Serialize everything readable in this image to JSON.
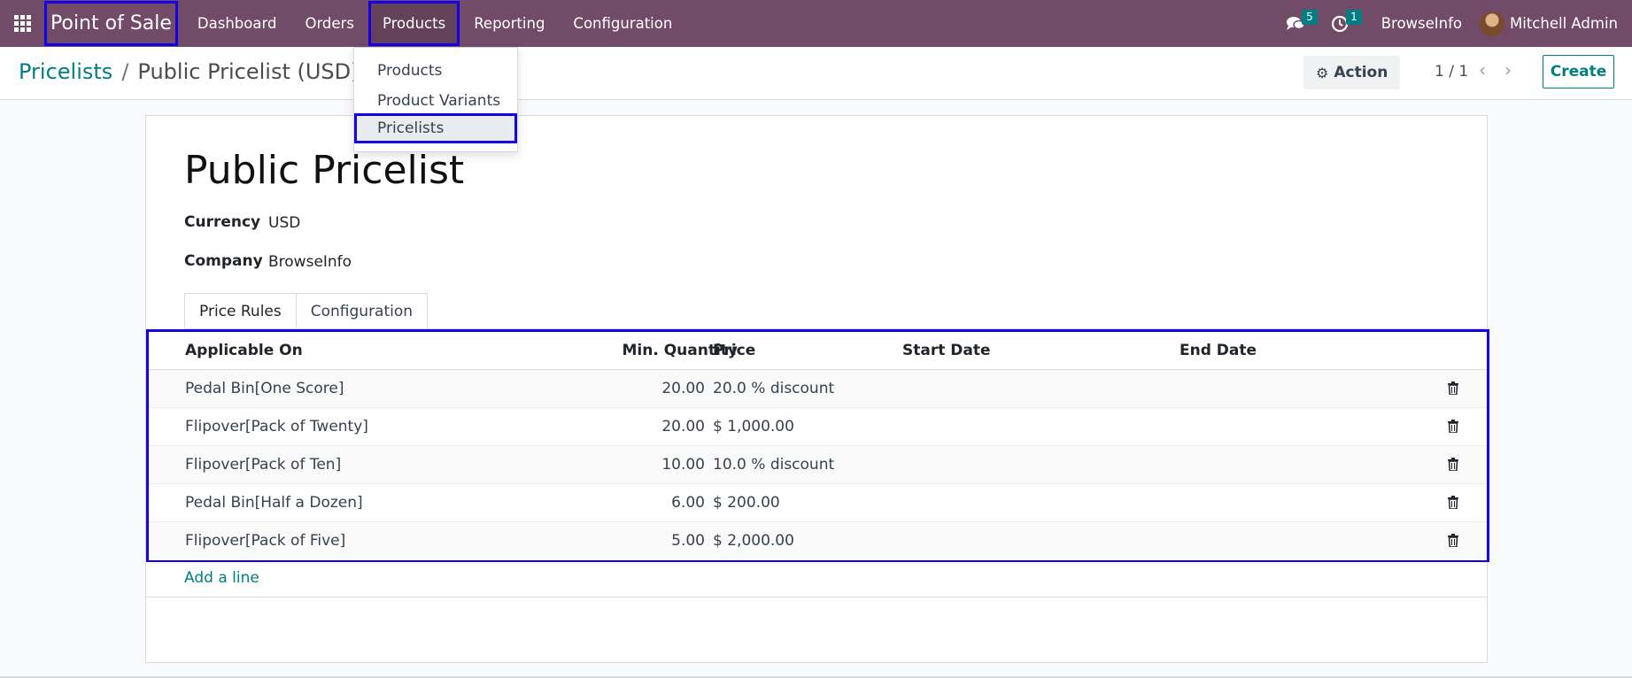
{
  "navbar": {
    "brand": "Point of Sale",
    "items": [
      {
        "label": "Dashboard"
      },
      {
        "label": "Orders"
      },
      {
        "label": "Products"
      },
      {
        "label": "Reporting"
      },
      {
        "label": "Configuration"
      }
    ],
    "messages_count": "5",
    "activities_count": "1",
    "company": "BrowseInfo",
    "user": "Mitchell Admin"
  },
  "products_menu": {
    "items": [
      {
        "label": "Products"
      },
      {
        "label": "Product Variants"
      },
      {
        "label": "Pricelists"
      }
    ]
  },
  "breadcrumb": {
    "parent": "Pricelists",
    "separator": "/",
    "current": "Public Pricelist (USD)"
  },
  "control": {
    "action_label": "Action",
    "pager": "1 / 1",
    "create_label": "Create"
  },
  "form": {
    "title": "Public Pricelist",
    "currency_label": "Currency",
    "currency_value": "USD",
    "company_label": "Company",
    "company_value": "BrowseInfo"
  },
  "tabs": [
    {
      "label": "Price Rules"
    },
    {
      "label": "Configuration"
    }
  ],
  "rules_table": {
    "headers": {
      "applicable_on": "Applicable On",
      "min_quantity": "Min. Quantity",
      "price": "Price",
      "start_date": "Start Date",
      "end_date": "End Date"
    },
    "rows": [
      {
        "applicable_on": "Pedal Bin[One Score]",
        "min_quantity": "20.00",
        "price": "20.0 % discount"
      },
      {
        "applicable_on": "Flipover[Pack of Twenty]",
        "min_quantity": "20.00",
        "price": "$ 1,000.00"
      },
      {
        "applicable_on": "Flipover[Pack of Ten]",
        "min_quantity": "10.00",
        "price": "10.0 % discount"
      },
      {
        "applicable_on": "Pedal Bin[Half a Dozen]",
        "min_quantity": "6.00",
        "price": "$ 200.00"
      },
      {
        "applicable_on": "Flipover[Pack of Five]",
        "min_quantity": "5.00",
        "price": "$ 2,000.00"
      }
    ],
    "add_line_label": "Add a line"
  },
  "colors": {
    "navbar": "#714b67",
    "accent": "#017e84",
    "highlight_border": "#1500e6"
  }
}
